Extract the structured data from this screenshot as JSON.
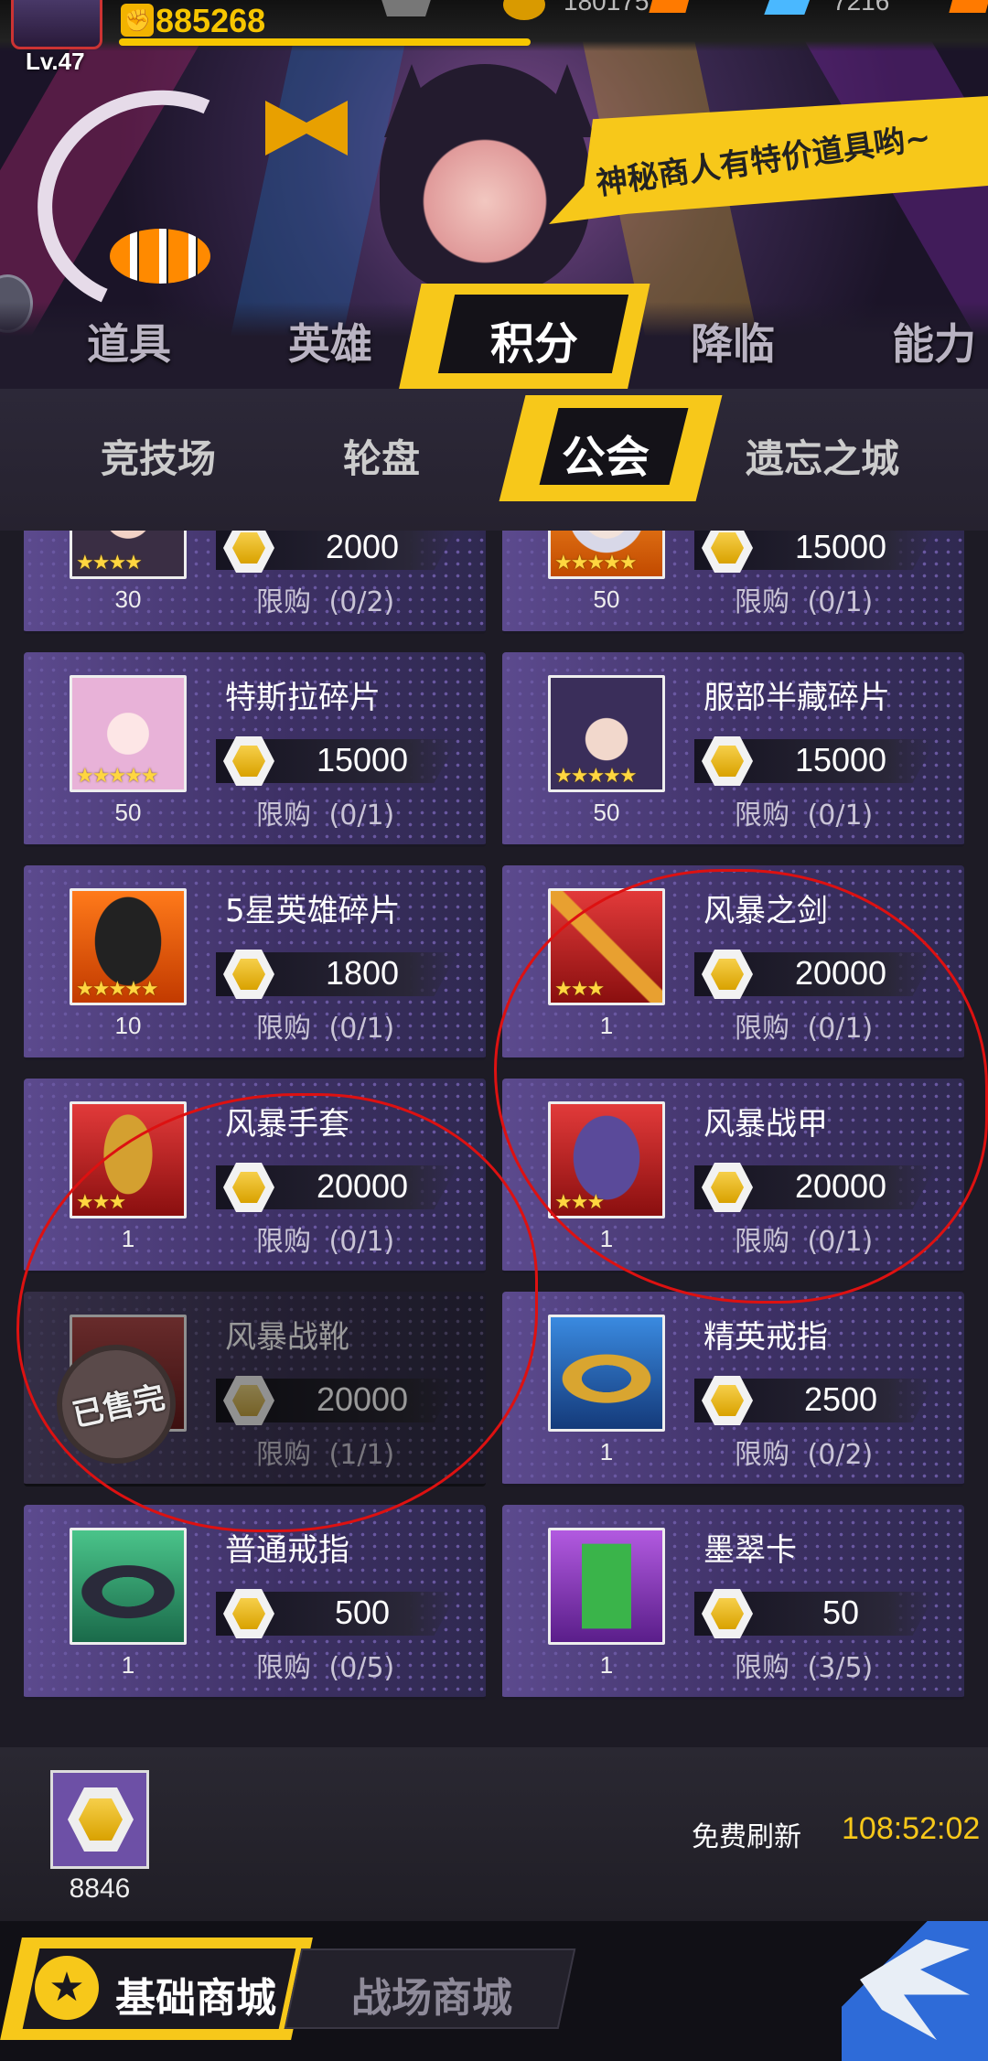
{
  "header": {
    "level": "Lv.47",
    "power_icon": "fist-icon",
    "power": "885268",
    "resource_1": "180175",
    "resource_2": "7216"
  },
  "banner": {
    "speech": "神秘商人有特价道具哟~"
  },
  "tabs": {
    "items": [
      "道具",
      "英雄",
      "积分",
      "降临",
      "能力"
    ],
    "active": "积分"
  },
  "subtabs": {
    "items": [
      "竞技场",
      "轮盘",
      "公会",
      "遗忘之城"
    ],
    "active": "公会"
  },
  "items": [
    {
      "name": "",
      "qty": "30",
      "price": "2000",
      "limit_label": "限购",
      "limit": "(0/2)",
      "stars": "★★★★",
      "icon": "hero-portrait-icon"
    },
    {
      "name": "",
      "qty": "50",
      "price": "15000",
      "limit_label": "限购",
      "limit": "(0/1)",
      "stars": "★★★★★",
      "icon": "hero-portrait-icon"
    },
    {
      "name": "特斯拉碎片",
      "qty": "50",
      "price": "15000",
      "limit_label": "限购",
      "limit": "(0/1)",
      "stars": "★★★★★",
      "icon": "hero-portrait-icon"
    },
    {
      "name": "服部半藏碎片",
      "qty": "50",
      "price": "15000",
      "limit_label": "限购",
      "limit": "(0/1)",
      "stars": "★★★★★",
      "icon": "hero-portrait-icon"
    },
    {
      "name": "5星英雄碎片",
      "qty": "10",
      "price": "1800",
      "limit_label": "限购",
      "limit": "(0/1)",
      "stars": "★★★★★",
      "icon": "mystery-hero-icon"
    },
    {
      "name": "风暴之剑",
      "qty": "1",
      "price": "20000",
      "limit_label": "限购",
      "limit": "(0/1)",
      "stars": "★★★",
      "icon": "sword-icon"
    },
    {
      "name": "风暴手套",
      "qty": "1",
      "price": "20000",
      "limit_label": "限购",
      "limit": "(0/1)",
      "stars": "★★★",
      "icon": "gauntlet-icon"
    },
    {
      "name": "风暴战甲",
      "qty": "1",
      "price": "20000",
      "limit_label": "限购",
      "limit": "(0/1)",
      "stars": "★★★",
      "icon": "armor-icon"
    },
    {
      "name": "风暴战靴",
      "qty": "1",
      "price": "20000",
      "limit_label": "限购",
      "limit": "(1/1)",
      "stars": "★★★",
      "icon": "boots-icon",
      "sold_out": "已售完"
    },
    {
      "name": "精英戒指",
      "qty": "1",
      "price": "2500",
      "limit_label": "限购",
      "limit": "(0/2)",
      "stars": "",
      "icon": "gold-ring-icon"
    },
    {
      "name": "普通戒指",
      "qty": "1",
      "price": "500",
      "limit_label": "限购",
      "limit": "(0/5)",
      "stars": "",
      "icon": "dark-ring-icon"
    },
    {
      "name": "墨翠卡",
      "qty": "1",
      "price": "50",
      "limit_label": "限购",
      "limit": "(3/5)",
      "stars": "",
      "icon": "green-card-icon"
    }
  ],
  "footer": {
    "currency_icon": "guild-coin-icon",
    "currency": "8846",
    "refresh_label": "免费刷新",
    "refresh_time": "108:52:02"
  },
  "nav": {
    "active": "基础商城",
    "other": "战场商城"
  },
  "colors": {
    "accent": "#f7c81a",
    "card": "#5c4a8e",
    "annotation": "#dd1111"
  }
}
